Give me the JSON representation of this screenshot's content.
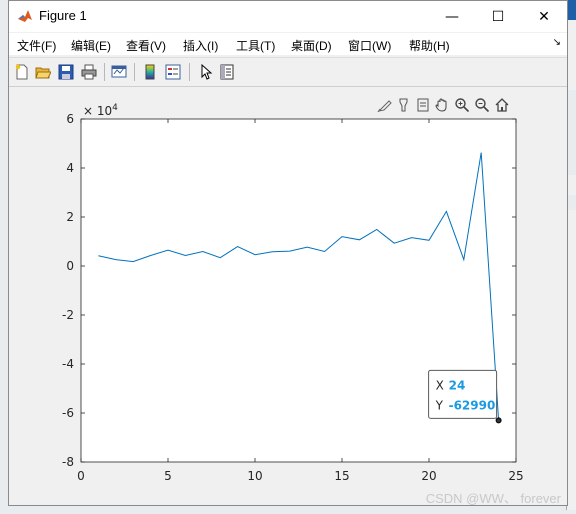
{
  "window": {
    "title": "Figure 1",
    "controls": {
      "minimize": "—",
      "maximize": "☐",
      "close": "✕"
    }
  },
  "menu": {
    "items": [
      "文件(F)",
      "编辑(E)",
      "查看(V)",
      "插入(I)",
      "工具(T)",
      "桌面(D)",
      "窗口(W)",
      "帮助(H)"
    ],
    "dock_arrow": "↘"
  },
  "toolbar": {
    "icons": [
      "new-figure-icon",
      "open-file-icon",
      "save-icon",
      "print-icon",
      "link-plot-icon",
      "insert-colorbar-icon",
      "insert-legend-icon",
      "edit-plot-icon",
      "property-inspector-icon"
    ]
  },
  "axes_toolbar": {
    "icons": [
      "brush-icon",
      "data-tips-icon",
      "rotate-icon",
      "pan-icon",
      "zoom-in-icon",
      "zoom-out-icon",
      "home-icon"
    ]
  },
  "chart_data": {
    "type": "line",
    "x": [
      1,
      2,
      3,
      4,
      5,
      6,
      7,
      8,
      9,
      10,
      11,
      12,
      13,
      14,
      15,
      16,
      17,
      18,
      19,
      20,
      21,
      22,
      23,
      24
    ],
    "y": [
      4200,
      2600,
      1800,
      4300,
      6500,
      4300,
      5900,
      3400,
      7900,
      4600,
      5800,
      6100,
      7700,
      5900,
      12000,
      10700,
      14900,
      9300,
      11600,
      10500,
      22300,
      2600,
      46300,
      -62990
    ],
    "xlim": [
      0,
      25
    ],
    "ylim": [
      -80000,
      60000
    ],
    "x_ticks": [
      "0",
      "5",
      "10",
      "15",
      "20",
      "25"
    ],
    "y_ticks": [
      "-8",
      "-6",
      "-4",
      "-2",
      "0",
      "2",
      "4",
      "6"
    ],
    "y_exponent": "× 10",
    "y_exponent_power": "4",
    "line_color": "#0072bd",
    "datatip": {
      "x_label": "X",
      "x_value": "24",
      "y_label": "Y",
      "y_value": "-62990",
      "value_color": "#1a9ae0"
    }
  },
  "watermark": "CSDN @WW、 forever"
}
